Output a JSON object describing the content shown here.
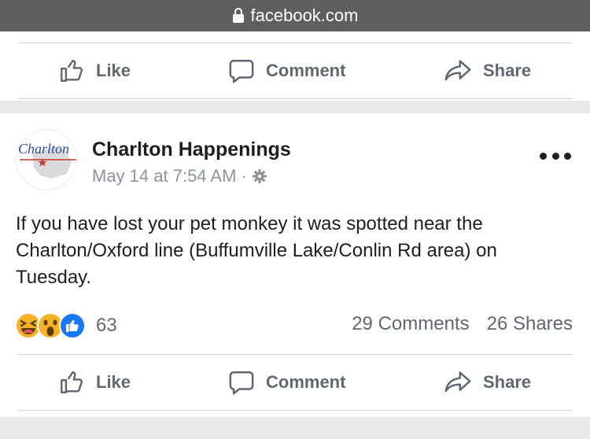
{
  "browser": {
    "url": "facebook.com"
  },
  "top_actions": {
    "like": "Like",
    "comment": "Comment",
    "share": "Share"
  },
  "post": {
    "page_name": "Charlton Happenings",
    "timestamp": "May 14 at 7:54 AM",
    "separator": "·",
    "avatar_text": "Charlton",
    "text": "If you have lost your pet monkey it was spotted near the Charlton/Oxford line (Buffumville Lake/Conlin Rd area) on Tuesday.",
    "reactions": [
      "laughing-emoji",
      "wow-emoji",
      "like-reaction"
    ],
    "reaction_count": "63",
    "comments": "29 Comments",
    "shares": "26 Shares"
  },
  "bottom_actions": {
    "like": "Like",
    "comment": "Comment",
    "share": "Share"
  },
  "colors": {
    "action_gray": "#606770",
    "meta_gray": "#8d949e",
    "separator": "#e7e8ea",
    "like_blue": "#1877f2",
    "emoji_yellow": "#f7b125"
  }
}
